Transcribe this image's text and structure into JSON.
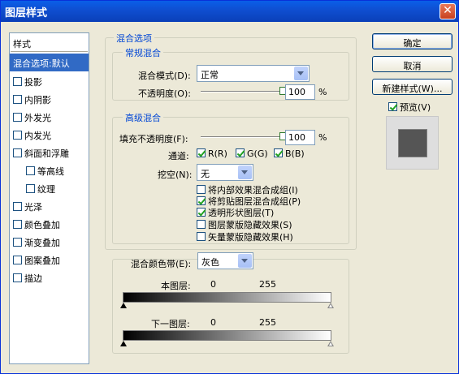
{
  "window": {
    "title": "图层样式",
    "close": "✕"
  },
  "sidebar": {
    "header": "样式",
    "items": [
      {
        "label": "混合选项:默认",
        "checkbox": false,
        "selected": true
      },
      {
        "label": "投影",
        "checkbox": true,
        "checked": false
      },
      {
        "label": "内阴影",
        "checkbox": true,
        "checked": false
      },
      {
        "label": "外发光",
        "checkbox": true,
        "checked": false
      },
      {
        "label": "内发光",
        "checkbox": true,
        "checked": false
      },
      {
        "label": "斜面和浮雕",
        "checkbox": true,
        "checked": false
      },
      {
        "label": "等高线",
        "checkbox": true,
        "checked": false,
        "indent": true
      },
      {
        "label": "纹理",
        "checkbox": true,
        "checked": false,
        "indent": true
      },
      {
        "label": "光泽",
        "checkbox": true,
        "checked": false
      },
      {
        "label": "颜色叠加",
        "checkbox": true,
        "checked": false
      },
      {
        "label": "渐变叠加",
        "checkbox": true,
        "checked": false
      },
      {
        "label": "图案叠加",
        "checkbox": true,
        "checked": false
      },
      {
        "label": "描边",
        "checkbox": true,
        "checked": false
      }
    ]
  },
  "blend": {
    "title": "混合选项",
    "general": {
      "title": "常规混合",
      "mode_label": "混合模式(D):",
      "mode_value": "正常",
      "opacity_label": "不透明度(O):",
      "opacity_value": "100",
      "opacity_unit": "%",
      "opacity_fraction": 1.0
    },
    "advanced": {
      "title": "高级混合",
      "fill_label": "填充不透明度(F):",
      "fill_value": "100",
      "fill_unit": "%",
      "fill_fraction": 1.0,
      "channels_label": "通道:",
      "channel_r": "R(R)",
      "channel_g": "G(G)",
      "channel_b": "B(B)",
      "knockout_label": "挖空(N):",
      "knockout_value": "无",
      "options": [
        {
          "label": "将内部效果混合成组(I)",
          "checked": false
        },
        {
          "label": "将剪贴图层混合成组(P)",
          "checked": true
        },
        {
          "label": "透明形状图层(T)",
          "checked": true
        },
        {
          "label": "图层蒙版隐藏效果(S)",
          "checked": false
        },
        {
          "label": "矢量蒙版隐藏效果(H)",
          "checked": false
        }
      ]
    },
    "blend_if": {
      "label": "混合颜色带(E):",
      "value": "灰色",
      "this_layer": "本图层:",
      "this_min": "0",
      "this_max": "255",
      "under_layer": "下一图层:",
      "under_min": "0",
      "under_max": "255"
    }
  },
  "buttons": {
    "ok": "确定",
    "cancel": "取消",
    "new_style": "新建样式(W)...",
    "preview_label": "预览(V)"
  }
}
